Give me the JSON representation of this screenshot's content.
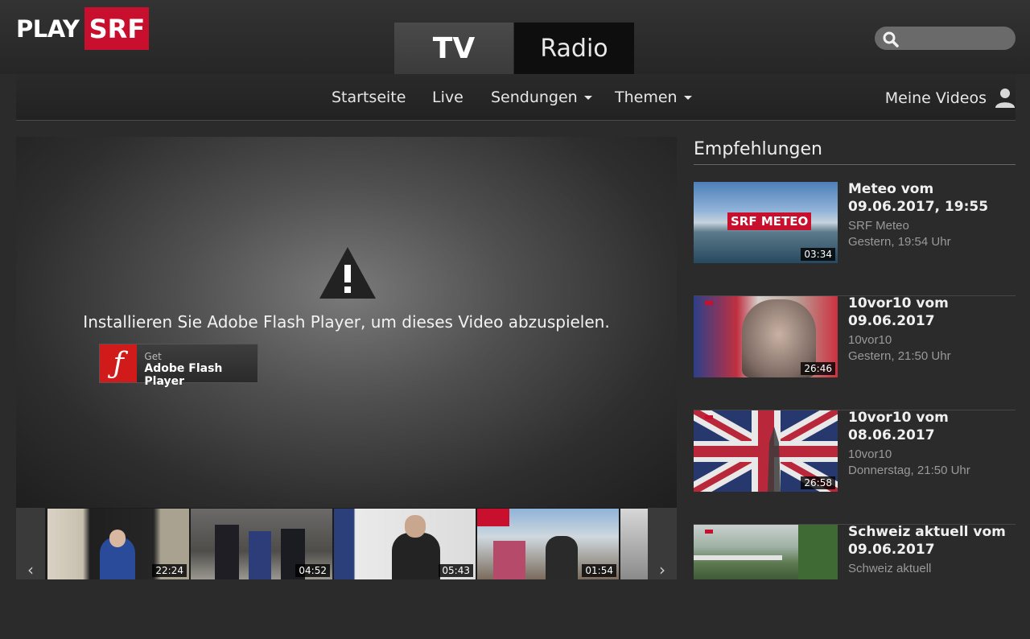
{
  "logo": {
    "play": "PLAY",
    "srf": "SRF"
  },
  "tabs": [
    {
      "label": "TV"
    },
    {
      "label": "Radio"
    }
  ],
  "search": {
    "placeholder": ""
  },
  "nav": {
    "items": [
      {
        "label": "Startseite"
      },
      {
        "label": "Live"
      },
      {
        "label": "Sendungen"
      },
      {
        "label": "Themen"
      }
    ],
    "meine_videos": "Meine Videos"
  },
  "player": {
    "message": "Installieren Sie Adobe Flash Player, um dieses Video abzuspielen.",
    "flash_get": "Get",
    "flash_name": "Adobe Flash Player"
  },
  "strip": {
    "items": [
      {
        "duration": "22:24"
      },
      {
        "duration": "04:52"
      },
      {
        "duration": "05:43"
      },
      {
        "duration": "01:54"
      }
    ]
  },
  "sidebar": {
    "title": "Empfehlungen",
    "items": [
      {
        "title": "Meteo vom 09.06.2017, 19:55",
        "show": "SRF Meteo",
        "date": "Gestern, 19:54 Uhr",
        "duration": "03:34",
        "logo_text": "SRF METEO"
      },
      {
        "title": "10vor10 vom 09.06.2017",
        "show": "10vor10",
        "date": "Gestern, 21:50 Uhr",
        "duration": "26:46"
      },
      {
        "title": "10vor10 vom 08.06.2017",
        "show": "10vor10",
        "date": "Donnerstag, 21:50 Uhr",
        "duration": "26:58"
      },
      {
        "title": "Schweiz aktuell vom 09.06.2017",
        "show": "Schweiz aktuell",
        "date": ""
      }
    ]
  }
}
